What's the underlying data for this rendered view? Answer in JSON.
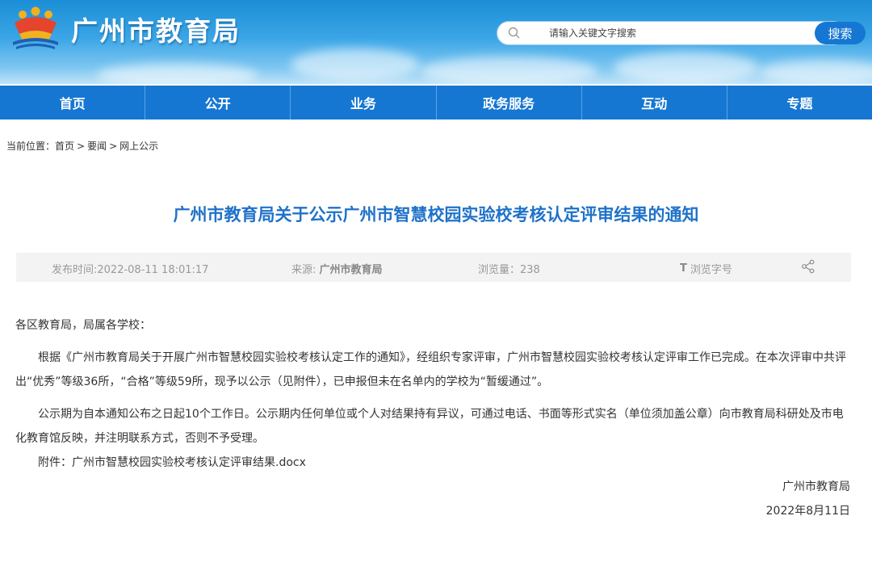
{
  "header": {
    "site_name": "广州市教育局",
    "search_placeholder": "请输入关键文字搜索",
    "search_button": "搜索",
    "colors": {
      "header_top": "#1c8ed6",
      "nav": "#1677d2",
      "title": "#1f72c9"
    }
  },
  "nav": {
    "items": [
      {
        "label": "首页"
      },
      {
        "label": "公开"
      },
      {
        "label": "业务"
      },
      {
        "label": "政务服务"
      },
      {
        "label": "互动"
      },
      {
        "label": "专题"
      }
    ]
  },
  "breadcrumb": {
    "prefix": "当前位置：",
    "items": [
      "首页",
      "要闻",
      "网上公示"
    ],
    "separator": ">"
  },
  "article": {
    "title": "广州市教育局关于公示广州市智慧校园实验校考核认定评审结果的通知",
    "meta": {
      "publish_time": "发布时间:2022-08-11 18:01:17",
      "source_label": "来源: ",
      "source_value": "广州市教育局",
      "views": "浏览量：238",
      "font_icon": "T",
      "font_label": "浏览字号"
    },
    "greeting": "各区教育局，局属各学校：",
    "paragraphs": [
      "根据《广州市教育局关于开展广州市智慧校园实验校考核认定工作的通知》，经组织专家评审，广州市智慧校园实验校考核认定评审工作已完成。在本次评审中共评出“优秀”等级36所，“合格”等级59所，现予以公示（见附件），已申报但未在名单内的学校为“暂缓通过”。",
      "公示期为自本通知公布之日起10个工作日。公示期内任何单位或个人对结果持有异议，可通过电话、书面等形式实名（单位须加盖公章）向市教育局科研处及市电化教育馆反映，并注明联系方式，否则不予受理。"
    ],
    "attachment_label": "附件：",
    "attachment_file": "广州市智慧校园实验校考核认定评审结果.docx",
    "signature": "广州市教育局",
    "sign_date": "2022年8月11日"
  }
}
